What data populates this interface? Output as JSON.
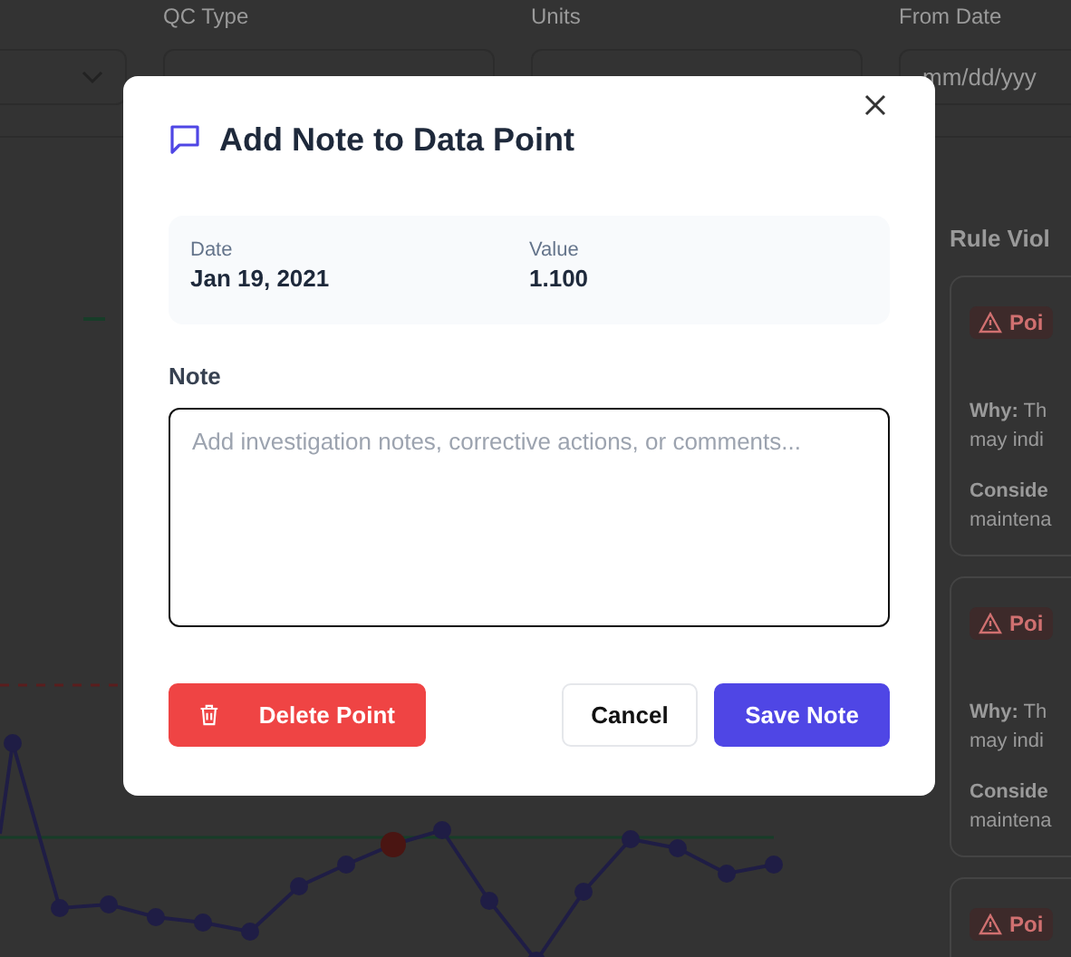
{
  "filters": [
    {
      "label": "QC Type"
    },
    {
      "label": "Units"
    },
    {
      "label": "From Date",
      "value": "mm/dd/yyy"
    }
  ],
  "rule_violations": {
    "title": "Rule Viol",
    "cards": [
      {
        "badge": "Poi",
        "why_label": "Why:",
        "why_text": "Th",
        "why_more": "may indi",
        "consider": "Conside",
        "consider_more": "maintena"
      },
      {
        "badge": "Poi",
        "why_label": "Why:",
        "why_text": "Th",
        "why_more": "may indi",
        "consider": "Conside",
        "consider_more": "maintena"
      },
      {
        "badge": "Poi"
      }
    ]
  },
  "dialog": {
    "title": "Add Note to Data Point",
    "date_label": "Date",
    "date": "Jan 19, 2021",
    "value_label": "Value",
    "value": "1.100",
    "note_label": "Note",
    "note_placeholder": "Add investigation notes, corrective actions, or comments...",
    "delete_button": "Delete Point",
    "cancel_button": "Cancel",
    "save_button": "Save Note"
  }
}
